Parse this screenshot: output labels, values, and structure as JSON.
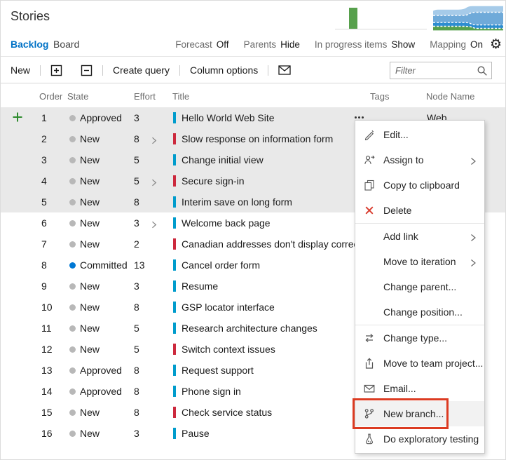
{
  "page": {
    "title": "Stories"
  },
  "tabs": {
    "backlog": "Backlog",
    "board": "Board"
  },
  "view_controls": [
    {
      "id": "forecast",
      "label": "Forecast",
      "value": "Off"
    },
    {
      "id": "parents",
      "label": "Parents",
      "value": "Hide"
    },
    {
      "id": "in-progress-items",
      "label": "In progress items",
      "value": "Show"
    },
    {
      "id": "mapping",
      "label": "Mapping",
      "value": "On"
    }
  ],
  "toolbar": {
    "new": "New",
    "create_query": "Create query",
    "column_options": "Column options",
    "filter_placeholder": "Filter"
  },
  "table": {
    "headers": {
      "order": "Order",
      "state": "State",
      "effort": "Effort",
      "title": "Title",
      "tags": "Tags",
      "node": "Node Name"
    },
    "rows": [
      {
        "order": "1",
        "state": "Approved",
        "dot": "neutral",
        "effort": "3",
        "title": "Hello World Web Site",
        "type": "story",
        "expandable": false,
        "selected": true,
        "node": "Web",
        "context_button": true,
        "add_button": true
      },
      {
        "order": "2",
        "state": "New",
        "dot": "neutral",
        "effort": "8",
        "title": "Slow response on information form",
        "type": "bug",
        "expandable": true,
        "selected": true
      },
      {
        "order": "3",
        "state": "New",
        "dot": "neutral",
        "effort": "5",
        "title": "Change initial view",
        "type": "story",
        "expandable": false,
        "selected": true
      },
      {
        "order": "4",
        "state": "New",
        "dot": "neutral",
        "effort": "5",
        "title": "Secure sign-in",
        "type": "bug",
        "expandable": true,
        "selected": true
      },
      {
        "order": "5",
        "state": "New",
        "dot": "neutral",
        "effort": "8",
        "title": "Interim save on long form",
        "type": "story",
        "expandable": false,
        "selected": true
      },
      {
        "order": "6",
        "state": "New",
        "dot": "neutral",
        "effort": "3",
        "title": "Welcome back page",
        "type": "story",
        "expandable": true,
        "selected": false
      },
      {
        "order": "7",
        "state": "New",
        "dot": "neutral",
        "effort": "2",
        "title": "Canadian addresses don't display correctly",
        "type": "bug",
        "expandable": false,
        "selected": false
      },
      {
        "order": "8",
        "state": "Committed",
        "dot": "committed",
        "effort": "13",
        "title": "Cancel order form",
        "type": "story",
        "expandable": false,
        "selected": false
      },
      {
        "order": "9",
        "state": "New",
        "dot": "neutral",
        "effort": "3",
        "title": "Resume",
        "type": "story",
        "expandable": false,
        "selected": false
      },
      {
        "order": "10",
        "state": "New",
        "dot": "neutral",
        "effort": "8",
        "title": "GSP locator interface",
        "type": "story",
        "expandable": false,
        "selected": false
      },
      {
        "order": "11",
        "state": "New",
        "dot": "neutral",
        "effort": "5",
        "title": "Research architecture changes",
        "type": "story",
        "expandable": false,
        "selected": false
      },
      {
        "order": "12",
        "state": "New",
        "dot": "neutral",
        "effort": "5",
        "title": "Switch context issues",
        "type": "bug",
        "expandable": false,
        "selected": false
      },
      {
        "order": "13",
        "state": "Approved",
        "dot": "neutral",
        "effort": "8",
        "title": "Request support",
        "type": "story",
        "expandable": false,
        "selected": false
      },
      {
        "order": "14",
        "state": "Approved",
        "dot": "neutral",
        "effort": "8",
        "title": "Phone sign in",
        "type": "story",
        "expandable": false,
        "selected": false
      },
      {
        "order": "15",
        "state": "New",
        "dot": "neutral",
        "effort": "8",
        "title": "Check service status",
        "type": "bug",
        "expandable": false,
        "selected": false
      },
      {
        "order": "16",
        "state": "New",
        "dot": "neutral",
        "effort": "3",
        "title": "Pause",
        "type": "story",
        "expandable": false,
        "selected": false
      }
    ]
  },
  "context_menu": {
    "items": [
      {
        "id": "edit",
        "label": "Edit...",
        "icon": "pencil-icon"
      },
      {
        "id": "assign-to",
        "label": "Assign to",
        "icon": "assign-person-icon",
        "submenu": true
      },
      {
        "id": "copy-to-clipboard",
        "label": "Copy to clipboard",
        "icon": "copy-icon"
      },
      {
        "id": "delete",
        "label": "Delete",
        "icon": "delete-x-icon"
      },
      {
        "divider": true
      },
      {
        "id": "add-link",
        "label": "Add link",
        "submenu": true
      },
      {
        "id": "move-to-iteration",
        "label": "Move to iteration",
        "submenu": true
      },
      {
        "id": "change-parent",
        "label": "Change parent..."
      },
      {
        "id": "change-position",
        "label": "Change position..."
      },
      {
        "divider": true
      },
      {
        "id": "change-type",
        "label": "Change type...",
        "icon": "change-type-icon"
      },
      {
        "id": "move-to-team-project",
        "label": "Move to team project...",
        "icon": "move-project-icon"
      },
      {
        "id": "email",
        "label": "Email...",
        "icon": "envelope-icon"
      },
      {
        "id": "new-branch",
        "label": "New branch...",
        "icon": "branch-icon",
        "highlighted": true,
        "annotated": true
      },
      {
        "id": "do-exploratory-testing",
        "label": "Do exploratory testing",
        "icon": "beaker-icon"
      }
    ]
  },
  "colors": {
    "accent": "#0072C6",
    "story_bar": "#009CCC",
    "bug_bar": "#CC293D",
    "committed_dot": "#0078D4",
    "neutral_dot": "#B8B8B8",
    "selection_bg": "#E9E9E9",
    "annotation_red": "#DC3B22",
    "add_green": "#2E8B2E",
    "delete_red": "#D83B2D",
    "velocity_green": "#57A04C",
    "cfd_bands": [
      "#A6CBE9",
      "#6FAAD9",
      "#2D8DD0",
      "#57A04C"
    ]
  },
  "chart_data": [
    {
      "type": "bar",
      "title": "velocity-thumbnail",
      "categories": [
        "sprint"
      ],
      "values": [
        1
      ],
      "note": "single green bar on gray baseline"
    },
    {
      "type": "area",
      "title": "cumulative-flow-thumbnail",
      "series": [
        {
          "name": "band-light-blue"
        },
        {
          "name": "band-medium-blue"
        },
        {
          "name": "band-bright-blue"
        },
        {
          "name": "band-green"
        }
      ],
      "note": "stacked stepped bands with white dashed separators"
    }
  ]
}
